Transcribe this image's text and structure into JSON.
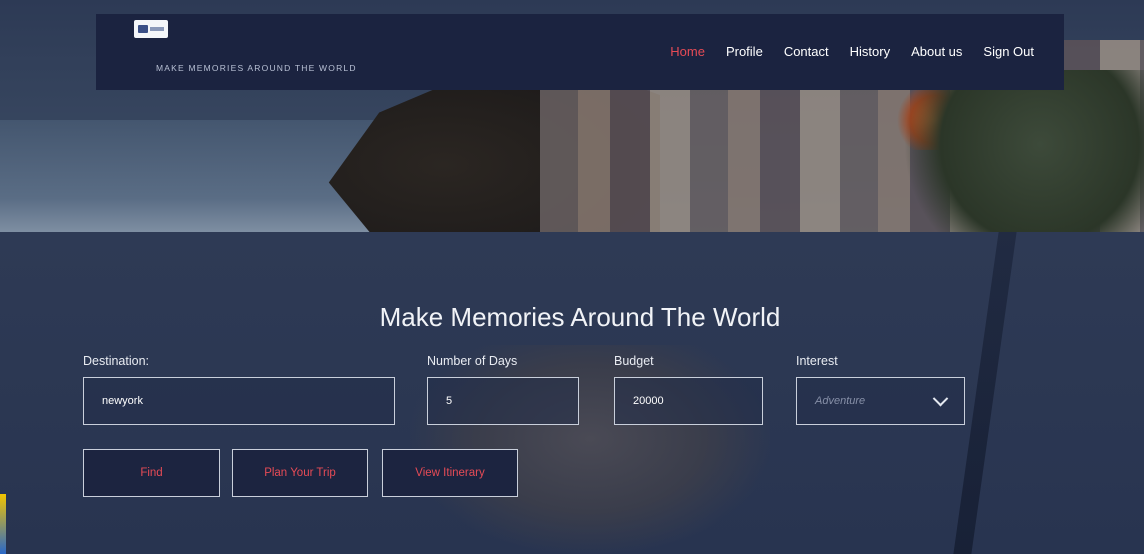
{
  "header": {
    "tagline": "MAKE MEMORIES AROUND THE WORLD",
    "nav": [
      {
        "label": "Home",
        "active": true
      },
      {
        "label": "Profile"
      },
      {
        "label": "Contact"
      },
      {
        "label": "History"
      },
      {
        "label": "About us"
      },
      {
        "label": "Sign Out"
      }
    ]
  },
  "main": {
    "title": "Make Memories Around The World",
    "form": {
      "destination_label": "Destination:",
      "destination_value": "newyork",
      "days_label": "Number of Days",
      "days_value": "5",
      "budget_label": "Budget",
      "budget_value": "20000",
      "interest_label": "Interest",
      "interest_value": "Adventure"
    },
    "buttons": {
      "find": "Find",
      "plan": "Plan Your Trip",
      "itinerary": "View Itinerary"
    }
  },
  "colors": {
    "accent": "#e64b56",
    "navbar": "#1b2340",
    "text": "#ffffff"
  },
  "icons": {
    "logo": "logo-icon",
    "dropdown": "chevron-down-icon"
  }
}
